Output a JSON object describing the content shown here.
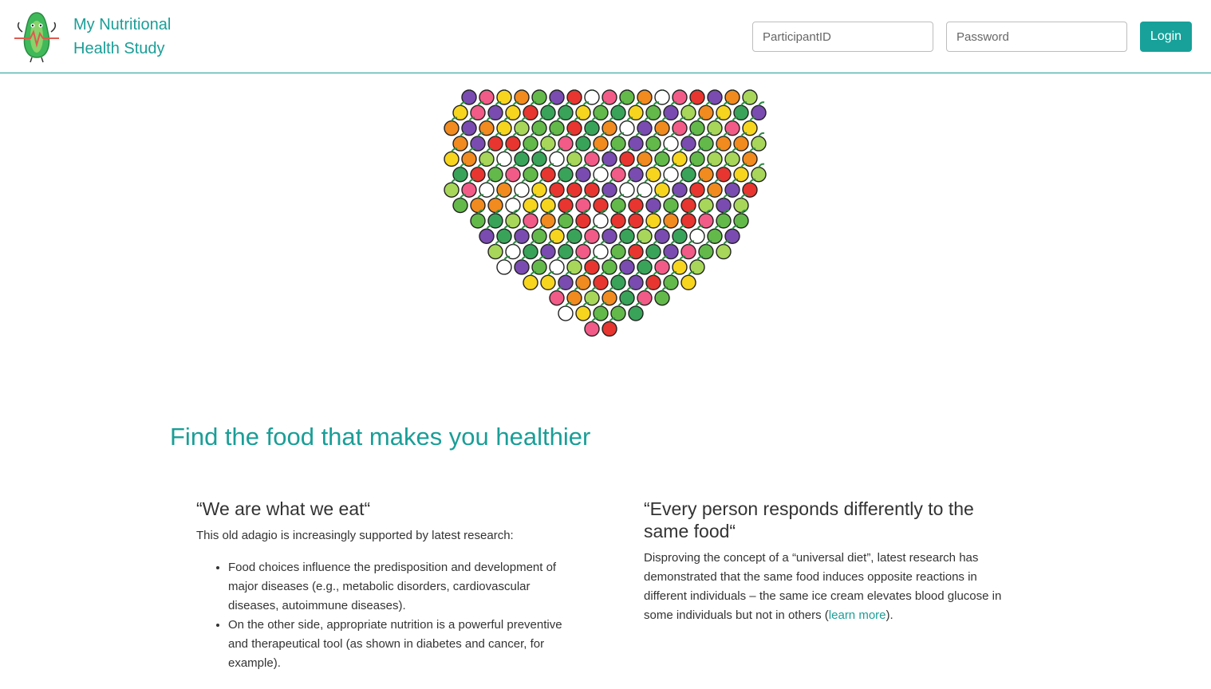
{
  "header": {
    "brand_line1": "My Nutritional",
    "brand_line2": "Health Study",
    "participant_placeholder": "ParticipantID",
    "password_placeholder": "Password",
    "login_label": "Login"
  },
  "hero": {
    "title": "Find the food that makes you healthier"
  },
  "left_column": {
    "heading": "“We are what we eat“",
    "intro": "This old adagio is increasingly supported by latest research:",
    "bullets": [
      "Food choices influence the predisposition and development of major diseases (e.g., metabolic disorders, cardiovascular diseases, autoimmune diseases).",
      "On the other side, appropriate nutrition is a powerful preventive and therapeutical tool (as shown in diabetes and cancer, for example)."
    ]
  },
  "right_column": {
    "heading": "“Every person responds differently to the same food“",
    "text_before_link": "Disproving the concept of a “universal diet”, latest research has demonstrated that the same food induces opposite reactions in different individuals – the same ice cream elevates blood glucose in some individuals but not in others (",
    "link_label": "learn more",
    "text_after_link": ")."
  },
  "colors": {
    "accent": "#1a9e97",
    "button": "#17a19a",
    "text": "#333333"
  },
  "icons": {
    "logo": "avocado-mascot-icon",
    "heart": "fruit-heart-illustration"
  }
}
